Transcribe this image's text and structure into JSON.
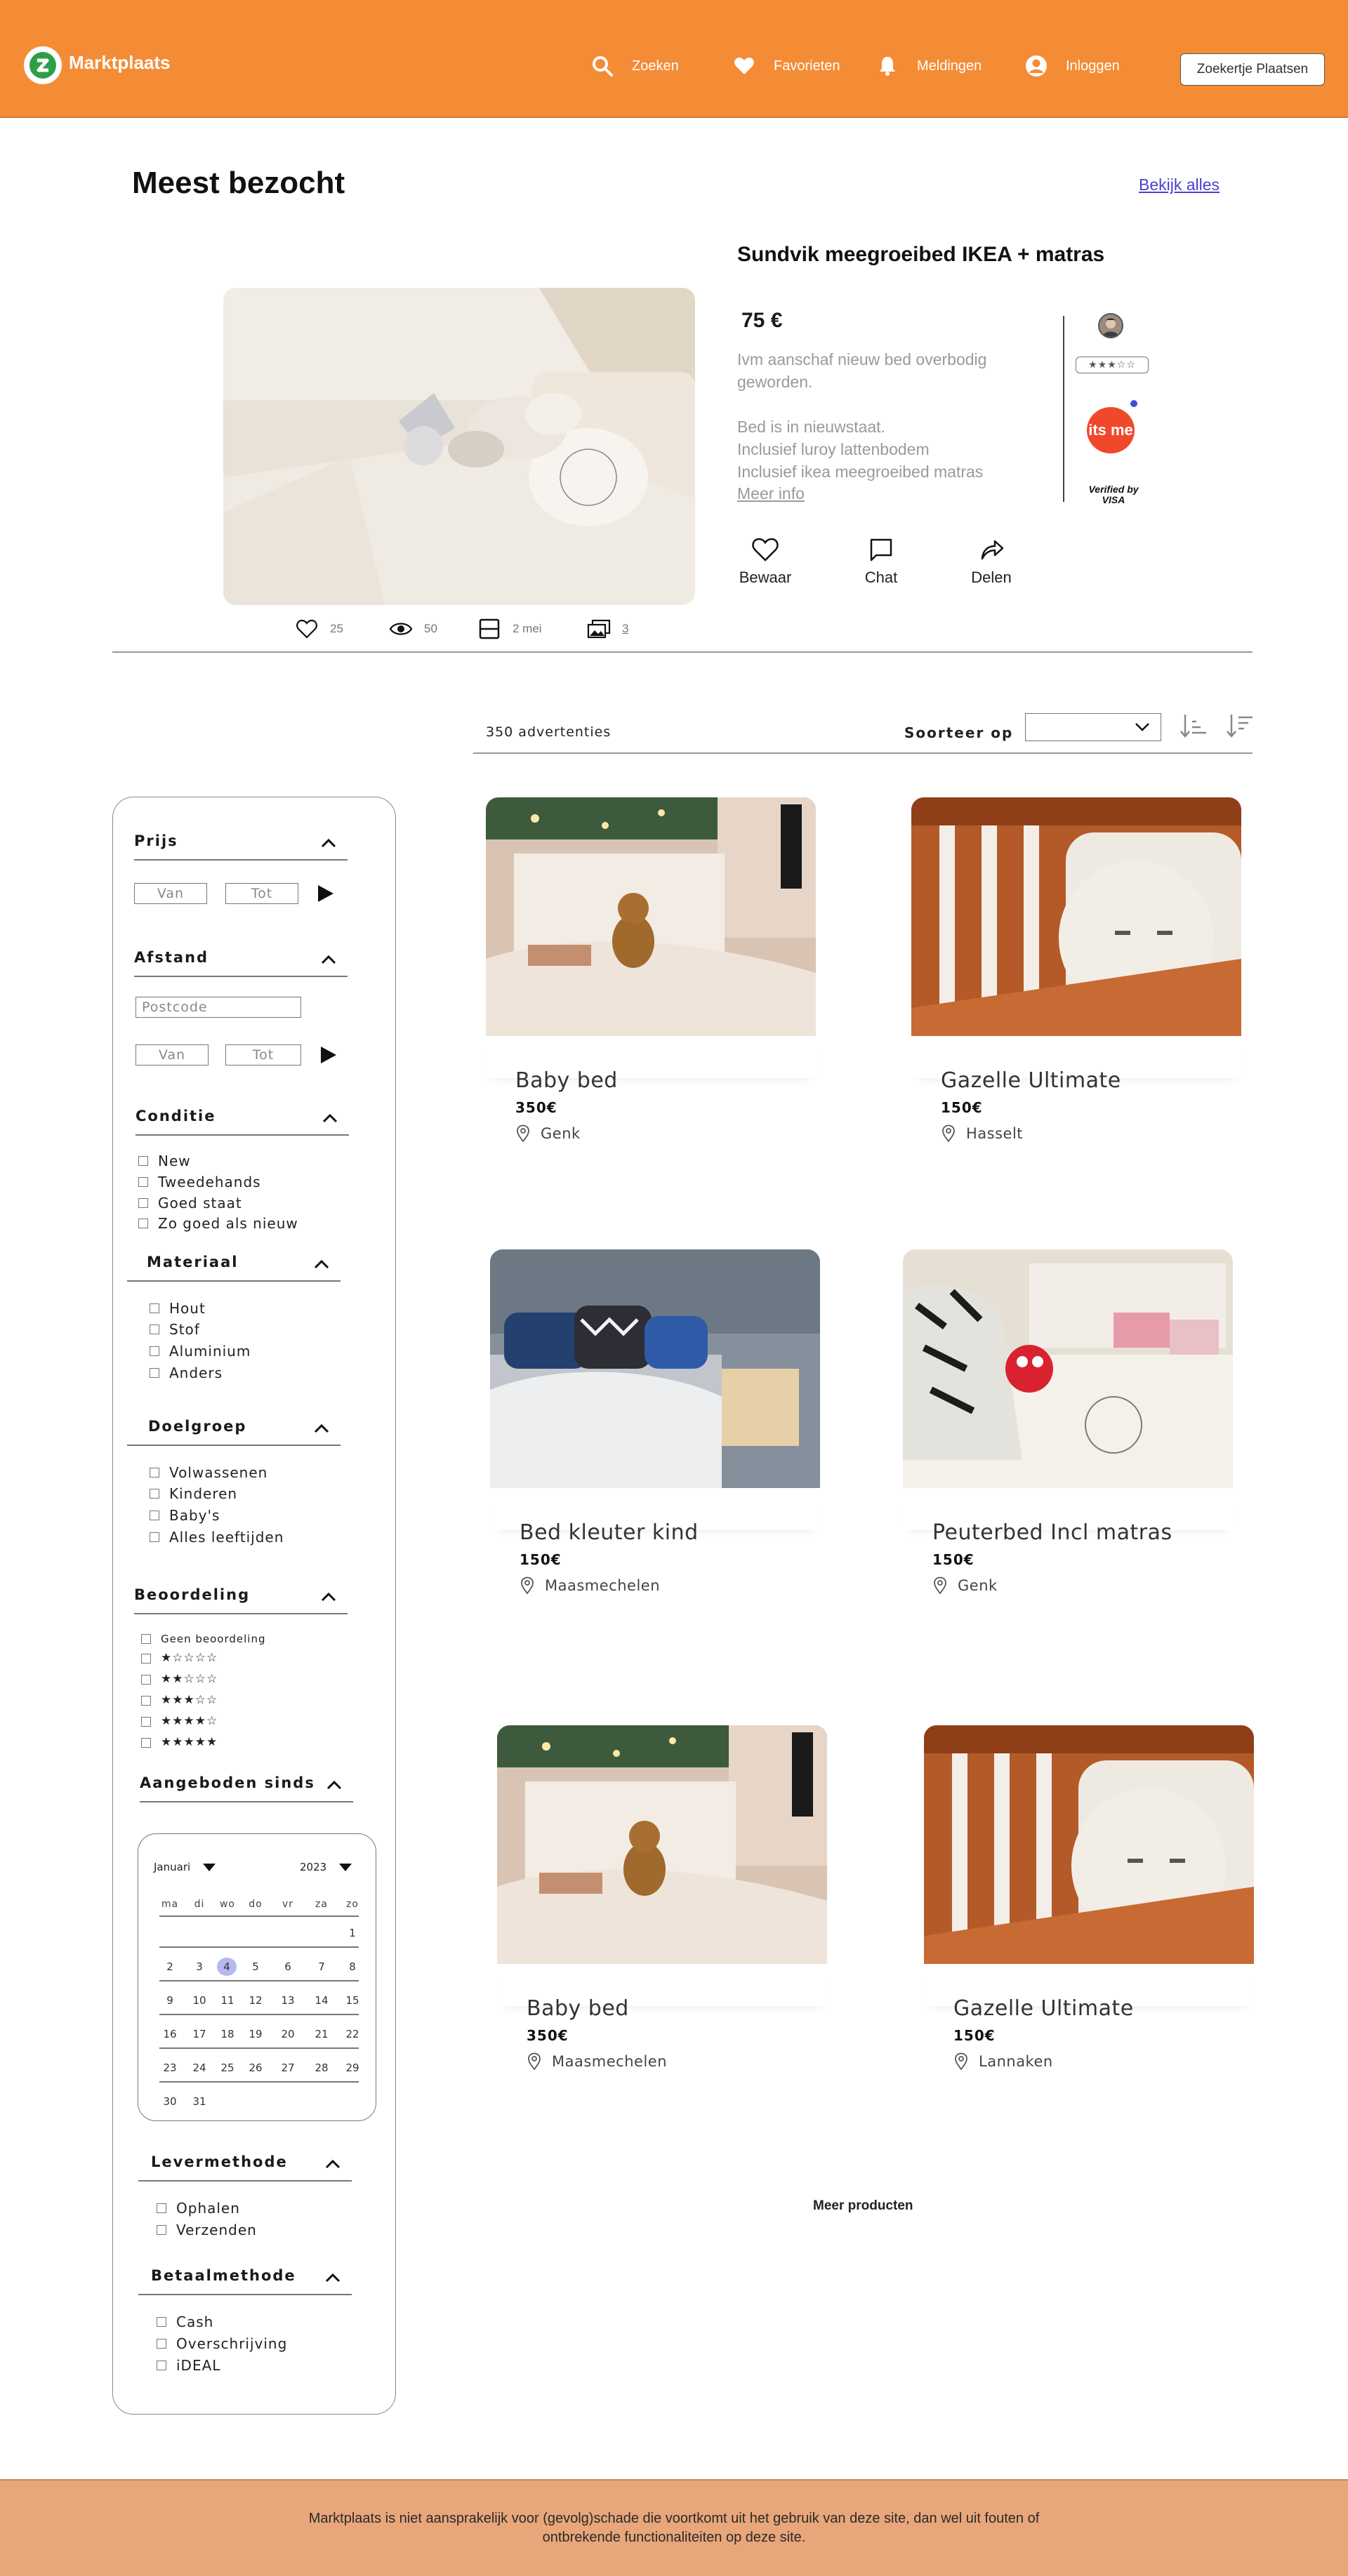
{
  "colors": {
    "header": "#f48c36",
    "footer": "#e8a67a",
    "link": "#4a3fd0",
    "selected_day": "#b5b9ef",
    "itsme": "#f0482a"
  },
  "header": {
    "logo": "Marktplaats",
    "nav": [
      {
        "label": "Zoeken",
        "icon": "search-icon"
      },
      {
        "label": "Favorieten",
        "icon": "heart-icon"
      },
      {
        "label": "Meldingen",
        "icon": "bell-icon"
      },
      {
        "label": "Inloggen",
        "icon": "user-icon"
      }
    ],
    "cta": "Zoekertje Plaatsen"
  },
  "most_visited": {
    "title": "Meest bezocht",
    "view_all": "Bekijk alles",
    "featured": {
      "title": "Sundvik meegroeibed IKEA + matras",
      "price": "75 €",
      "description": [
        "Ivm aanschaf nieuw bed overbodig geworden.",
        "Bed is in nieuwstaat.",
        "Inclusief luroy lattenbodem",
        "Inclusief ikea meegroeibed matras"
      ],
      "more_info": "Meer info",
      "seller_rating": "★★★☆☆",
      "badge_itsme": "its me",
      "badge_visa": "Verified by VISA",
      "actions": [
        "Bewaar",
        "Chat",
        "Delen"
      ],
      "stats": {
        "likes": "25",
        "views": "50",
        "date": "2 mei",
        "photos": "3"
      }
    }
  },
  "results": {
    "count": "350 advertenties",
    "sort_label": "Soorteer op",
    "sort_value": ""
  },
  "filters": {
    "price": {
      "title": "Prijs",
      "from": "Van",
      "to": "Tot"
    },
    "distance": {
      "title": "Afstand",
      "postcode": "Postcode",
      "from": "Van",
      "to": "Tot"
    },
    "condition": {
      "title": "Conditie",
      "options": [
        "New",
        "Tweedehands",
        "Goed staat",
        "Zo goed als nieuw"
      ]
    },
    "material": {
      "title": "Materiaal",
      "options": [
        "Hout",
        "Stof",
        "Aluminium",
        "Anders"
      ]
    },
    "audience": {
      "title": "Doelgroep",
      "options": [
        "Volwassenen",
        "Kinderen",
        "Baby's",
        "Alles leeftijden"
      ]
    },
    "rating": {
      "title": "Beoordeling",
      "none": "Geen beoordeling",
      "stars": [
        "★☆☆☆☆",
        "★★☆☆☆",
        "★★★☆☆",
        "★★★★☆",
        "★★★★★"
      ]
    },
    "since": {
      "title": "Aangeboden sinds",
      "month": "Januari",
      "year": "2023",
      "weekdays": [
        "ma",
        "di",
        "wo",
        "do",
        "vr",
        "za",
        "zo"
      ],
      "weeks": [
        [
          "",
          "",
          "",
          "",
          "",
          "",
          "1"
        ],
        [
          "2",
          "3",
          "4",
          "5",
          "6",
          "7",
          "8"
        ],
        [
          "9",
          "10",
          "11",
          "12",
          "13",
          "14",
          "15"
        ],
        [
          "16",
          "17",
          "18",
          "19",
          "20",
          "21",
          "22"
        ],
        [
          "23",
          "24",
          "25",
          "26",
          "27",
          "28",
          "29"
        ],
        [
          "30",
          "31",
          "",
          "",
          "",
          "",
          ""
        ]
      ],
      "selected_day": "4"
    },
    "delivery": {
      "title": "Levermethode",
      "options": [
        "Ophalen",
        "Verzenden"
      ]
    },
    "payment": {
      "title": "Betaalmethode",
      "options": [
        "Cash",
        "Overschrijving",
        "iDEAL"
      ]
    }
  },
  "products": [
    {
      "title": "Baby bed",
      "price": "350€",
      "location": "Genk",
      "photo": "teddy-bed-photo"
    },
    {
      "title": "Gazelle Ultimate",
      "price": "150€",
      "location": "Hasselt",
      "photo": "crib-pillow-photo"
    },
    {
      "title": "Bed kleuter kind",
      "price": "150€",
      "location": "Maasmechelen",
      "photo": "bedroom-bed-photo"
    },
    {
      "title": "Peuterbed Incl matras",
      "price": "150€",
      "location": "Genk",
      "photo": "toddler-bed-photo"
    },
    {
      "title": "Baby bed",
      "price": "350€",
      "location": "Maasmechelen",
      "photo": "teddy-bed-photo"
    },
    {
      "title": "Gazelle Ultimate",
      "price": "150€",
      "location": "Lannaken",
      "photo": "crib-pillow-photo"
    }
  ],
  "more_products": "Meer producten",
  "footer": "Marktplaats is niet aansprakelijk voor (gevolg)schade die voortkomt uit het gebruik van deze site, dan wel uit fouten of ontbrekende functionaliteiten op deze site."
}
